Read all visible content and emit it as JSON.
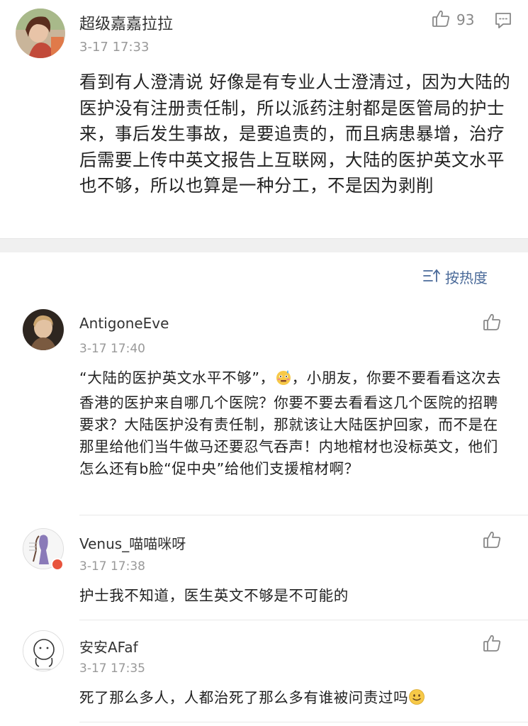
{
  "main_comment": {
    "username": "超级嘉嘉拉拉",
    "time": "3-17 17:33",
    "like_count": "93",
    "text": "看到有人澄清说 好像是有专业人士澄清过，因为大陆的医护没有注册责任制，所以派药注射都是医管局的护士来，事后发生事故，是要追责的，而且病患暴增，治疗后需要上传中英文报告上互联网，大陆的医护英文水平也不够，所以也算是一种分工，不是因为剥削"
  },
  "sort": {
    "label": "按热度",
    "icon": "sort-icon"
  },
  "replies": [
    {
      "username": "AntigoneEve",
      "time": "3-17 17:40",
      "text_part1": "“大陆的医护英文水平不够”，",
      "emoji": "embarrassed-emoji",
      "text_part2": "，小朋友，你要不要看看这次去香港的医护来自哪几个医院？你要不要去看看这几个医院的招聘要求？大陆医护没有责任制，那就该让大陆医护回家，而不是在那里给他们当牛做马还要忍气吞声！内地棺材也没标英文，他们怎么还有b脸“促中央”给他们支援棺材啊？"
    },
    {
      "username": "Venus_喵喵咪呀",
      "time": "3-17 17:38",
      "text": "护士我不知道，医生英文不够是不可能的"
    },
    {
      "username": "安安AFaf",
      "time": "3-17 17:35",
      "text": "死了那么多人，人都治死了那么多有谁被问责过吗",
      "emoji": "smile-emoji"
    }
  ],
  "colors": {
    "accent_link": "#4a6a99",
    "meta_gray": "#999999",
    "band_gray": "#f0f0f0"
  }
}
